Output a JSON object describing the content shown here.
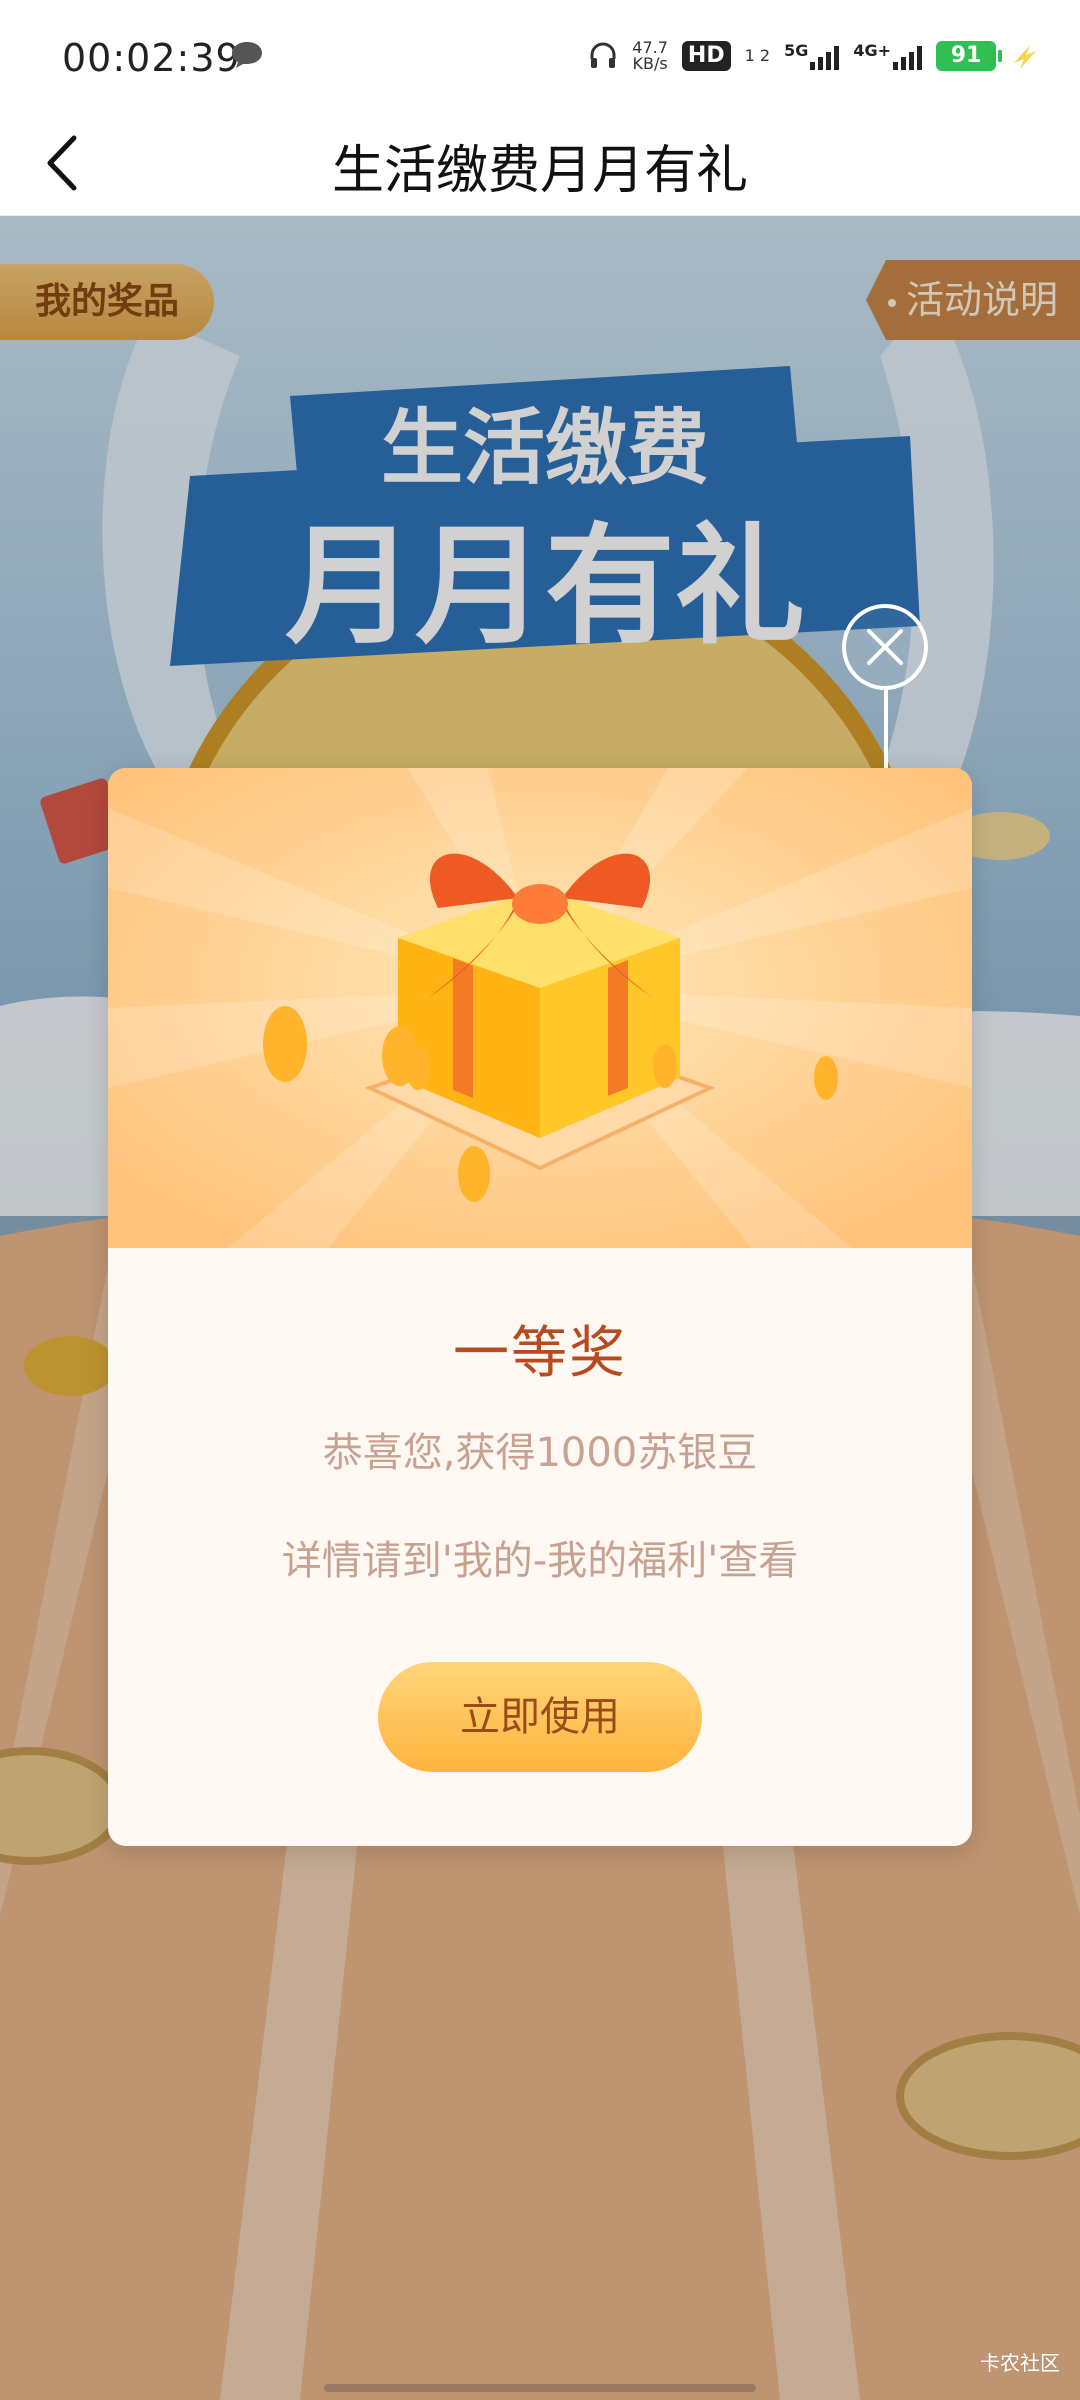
{
  "status_bar": {
    "time": "00:02:39",
    "speed_value": "47.7",
    "speed_unit": "KB/s",
    "hd_label": "HD",
    "sim_slot": "1 2",
    "net_5g": "5G",
    "net_4g": "4G+",
    "battery": "91"
  },
  "nav": {
    "title": "生活缴费月月有礼"
  },
  "page": {
    "prize_tab": "我的奖品",
    "rules_tab": "活动说明",
    "hero_line1": "生活缴费",
    "hero_line2": "月月有礼"
  },
  "modal": {
    "prize_name": "一等奖",
    "description": "恭喜您,获得1000苏银豆",
    "hint": "详情请到'我的-我的福利'查看",
    "use_button": "立即使用"
  },
  "footer": {
    "watermark": "卡农社区"
  },
  "colors": {
    "accent": "#ffb43e",
    "title_text": "#b64a21",
    "muted_text": "#c8a291",
    "battery": "#2fbf52"
  },
  "icons": {
    "back": "chevron-left-icon",
    "close": "close-icon",
    "message": "message-icon",
    "headphones": "headphones-icon",
    "bolt": "charging-icon",
    "gift": "gift-box-icon"
  }
}
